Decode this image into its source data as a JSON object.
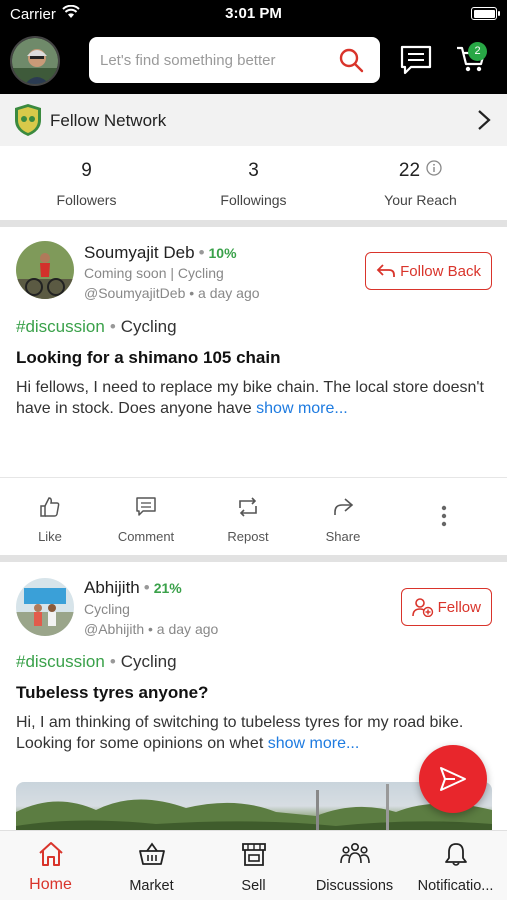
{
  "status_bar": {
    "carrier": "Carrier",
    "time": "3:01 PM"
  },
  "header": {
    "search_placeholder": "Let's find something better",
    "cart_count": "2"
  },
  "network": {
    "title": "Fellow Network"
  },
  "stats": [
    {
      "value": "9",
      "label": "Followers"
    },
    {
      "value": "3",
      "label": "Followings"
    },
    {
      "value": "22",
      "label": "Your Reach"
    }
  ],
  "posts": [
    {
      "author": "Soumyajit Deb",
      "percent": "10%",
      "subtitle": "Coming soon | Cycling",
      "meta": "@SoumyajitDeb • a day ago",
      "follow_label": "Follow Back",
      "tag": "#discussion",
      "category": "Cycling",
      "title": "Looking for a shimano 105 chain",
      "body": "Hi fellows, I need to replace my bike chain. The local store doesn't have in stock. Does anyone have ",
      "more": "show more..."
    },
    {
      "author": "Abhijith",
      "percent": "21%",
      "subtitle": "Cycling",
      "meta": "@Abhijith • a day ago",
      "follow_label": "Fellow",
      "tag": "#discussion",
      "category": "Cycling",
      "title": "Tubeless tyres anyone?",
      "body": "Hi, I am thinking of switching to tubeless tyres for my road bike. Looking for some opinions on whet ",
      "more": "show more..."
    }
  ],
  "actions": {
    "like": "Like",
    "comment": "Comment",
    "repost": "Repost",
    "share": "Share"
  },
  "tabs": [
    {
      "label": "Home",
      "icon": "home-icon",
      "active": true
    },
    {
      "label": "Market",
      "icon": "basket-icon"
    },
    {
      "label": "Sell",
      "icon": "store-icon"
    },
    {
      "label": "Discussions",
      "icon": "group-icon"
    },
    {
      "label": "Notificatio...",
      "icon": "bell-icon"
    }
  ],
  "colors": {
    "accent": "#d9342b",
    "green": "#3aa14a",
    "link": "#1e7be0",
    "badge": "#28a745"
  }
}
